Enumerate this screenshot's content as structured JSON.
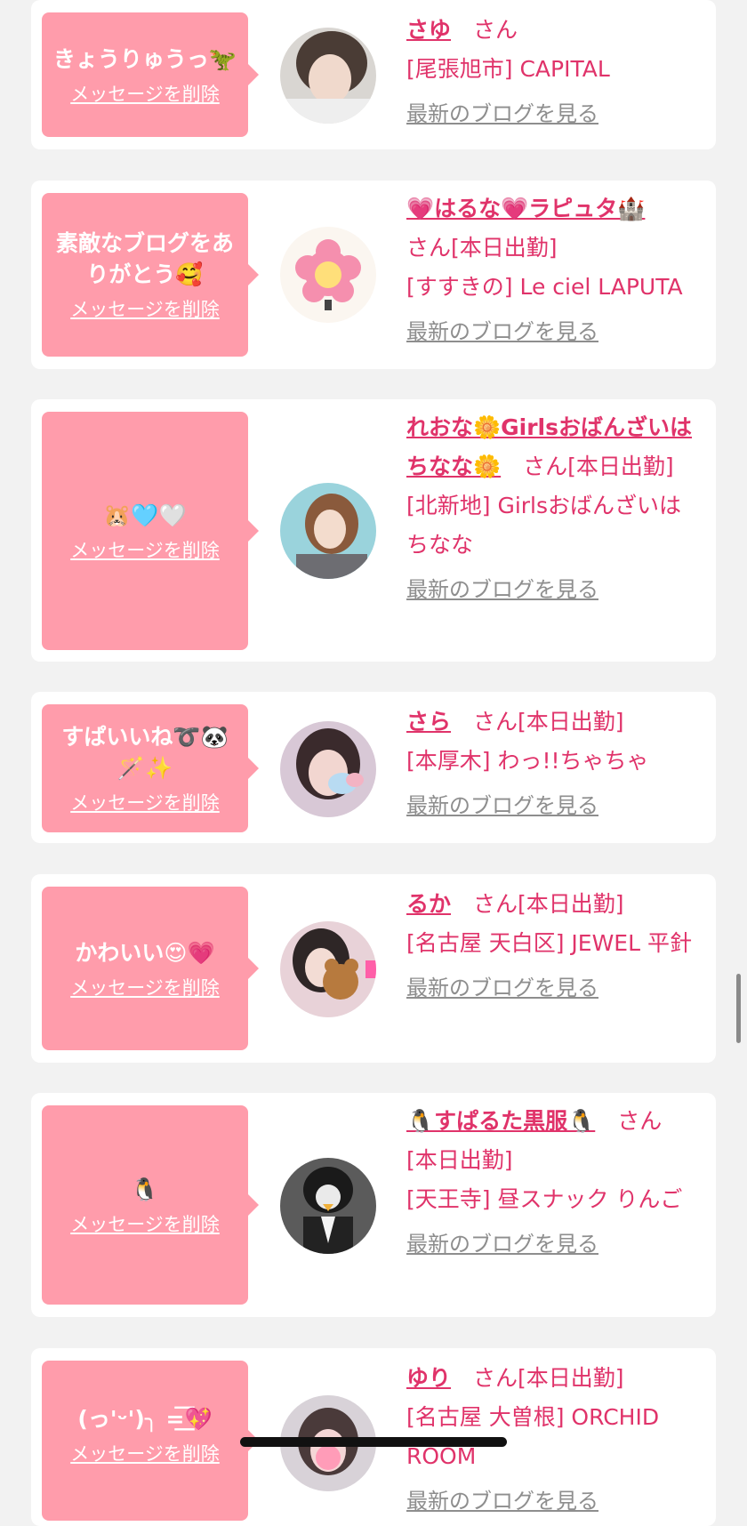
{
  "entries": [
    {
      "message": "きょうりゅうっ🦖",
      "delete_label": "メッセージを削除",
      "name": "さゆ",
      "san": "さん",
      "status": "",
      "shop": "[尾張旭市] CAPITAL",
      "blog_label": "最新のブログを見る"
    },
    {
      "message": "素敵なブログをありがとう🥰",
      "delete_label": "メッセージを削除",
      "name": "💗はるな💗ラピュタ🏰",
      "san": "さん",
      "status": "[本日出勤]",
      "shop": "[すすきの] Le ciel LAPUTA",
      "blog_label": "最新のブログを見る"
    },
    {
      "message": "🐹🩵🤍",
      "delete_label": "メッセージを削除",
      "name": "れおな🌼Girlsおばんざいはちなな🌼",
      "san": "さん",
      "status": "[本日出勤]",
      "shop": "[北新地] Girlsおばんざいはちなな",
      "blog_label": "最新のブログを見る"
    },
    {
      "message": "すぱいいね➰🐼🪄✨",
      "delete_label": "メッセージを削除",
      "name": "さら",
      "san": "さん",
      "status": "[本日出勤]",
      "shop": "[本厚木] わっ!!ちゃちゃ",
      "blog_label": "最新のブログを見る"
    },
    {
      "message": "かわいい😍💗",
      "delete_label": "メッセージを削除",
      "name": "るか",
      "san": "さん",
      "status": "[本日出勤]",
      "shop": "[名古屋 天白区] JEWEL 平針",
      "blog_label": "最新のブログを見る"
    },
    {
      "message": "🐧",
      "delete_label": "メッセージを削除",
      "name": "🐧すぱるた黒服🐧",
      "san": "さん",
      "status": "[本日出勤]",
      "shop": "[天王寺] 昼スナック りんご",
      "blog_label": "最新のブログを見る"
    },
    {
      "message": "(っ'ᵕ')╮ =͟͟͞͞💖",
      "delete_label": "メッセージを削除",
      "name": "ゆり",
      "san": "さん",
      "status": "[本日出勤]",
      "shop": "[名古屋 大曽根] ORCHID ROOM",
      "blog_label": "最新のブログを見る"
    }
  ],
  "colors": {
    "accent": "#e0336a",
    "bubble": "#ff9cab",
    "link_gray": "#8e8e8e",
    "background": "#f2f2f2"
  }
}
